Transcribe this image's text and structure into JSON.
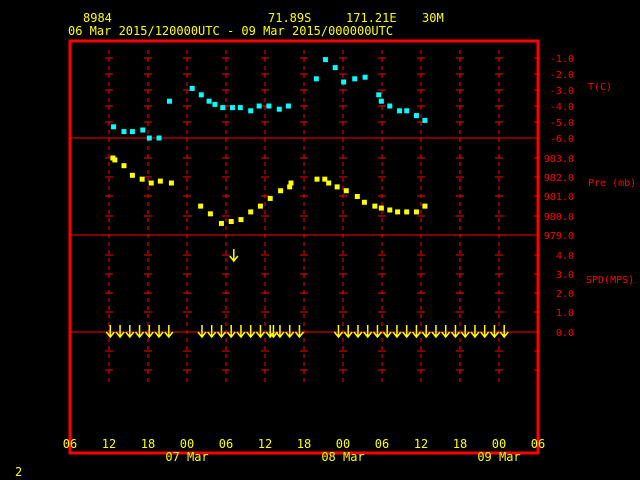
{
  "header": {
    "station_id": "8984",
    "latitude": "71.89S",
    "longitude": "171.21E",
    "elevation": "30M",
    "time_range": "06 Mar 2015/120000UTC - 09 Mar 2015/000000UTC"
  },
  "footer": {
    "corner_label": "2"
  },
  "colors": {
    "background": "#000000",
    "frame": "#ff0000",
    "grid": "#ff0000",
    "axis_text": "#ffff00",
    "header_text": "#ffff00",
    "temperature": "#00ffff",
    "pressure": "#ffff00",
    "wind": "#ffff00"
  },
  "chart_data": {
    "type": "scatter",
    "x_unit": "hours since 06 Mar 2015 06 UTC",
    "x_range": [
      0,
      72
    ],
    "x_tick_labels": [
      "06",
      "12",
      "18",
      "00",
      "06",
      "12",
      "18",
      "00",
      "06",
      "12",
      "18",
      "00",
      "06"
    ],
    "date_labels": [
      {
        "text": "07 Mar",
        "at_tick": 3
      },
      {
        "text": "08 Mar",
        "at_tick": 7
      },
      {
        "text": "09 Mar",
        "at_tick": 11
      }
    ],
    "panels": [
      {
        "name": "temperature",
        "axis_label": "T(C)",
        "y_ticks": [
          "-1.0",
          "-2.0",
          "-3.0",
          "-4.0",
          "-5.0",
          "-6.0"
        ],
        "y_range": [
          -6.3,
          -0.5
        ],
        "series": [
          {
            "points": [
              [
                6.7,
                -5.3
              ],
              [
                8.3,
                -5.6
              ],
              [
                9.6,
                -5.6
              ],
              [
                11.2,
                -5.5
              ],
              [
                12.2,
                -6.0
              ],
              [
                13.7,
                -6.0
              ],
              [
                15.3,
                -3.7
              ],
              [
                18.8,
                -2.9
              ],
              [
                20.2,
                -3.3
              ],
              [
                21.4,
                -3.7
              ],
              [
                22.3,
                -3.9
              ],
              [
                23.5,
                -4.1
              ],
              [
                25.0,
                -4.1
              ],
              [
                26.2,
                -4.1
              ],
              [
                27.8,
                -4.3
              ],
              [
                29.1,
                -4.0
              ],
              [
                30.6,
                -4.0
              ],
              [
                32.2,
                -4.2
              ],
              [
                33.6,
                -4.0
              ],
              [
                37.9,
                -2.3
              ],
              [
                39.3,
                -1.1
              ],
              [
                40.8,
                -1.6
              ],
              [
                42.1,
                -2.5
              ],
              [
                43.8,
                -2.3
              ],
              [
                45.4,
                -2.2
              ],
              [
                47.5,
                -3.3
              ],
              [
                47.9,
                -3.7
              ],
              [
                49.2,
                -4.0
              ],
              [
                50.7,
                -4.3
              ],
              [
                51.8,
                -4.3
              ],
              [
                53.3,
                -4.6
              ],
              [
                54.6,
                -4.9
              ]
            ]
          }
        ]
      },
      {
        "name": "pressure",
        "axis_label": "Pre (mb)",
        "y_ticks": [
          "983.0",
          "982.0",
          "981.0",
          "980.0",
          "979.0"
        ],
        "y_range": [
          978.95,
          983.4
        ],
        "series": [
          {
            "points": [
              [
                6.6,
                983.0
              ],
              [
                6.9,
                982.9
              ],
              [
                8.3,
                982.6
              ],
              [
                9.6,
                982.1
              ],
              [
                11.1,
                981.9
              ],
              [
                12.5,
                981.7
              ],
              [
                13.9,
                981.8
              ],
              [
                15.6,
                981.7
              ],
              [
                20.1,
                980.5
              ],
              [
                21.6,
                980.1
              ],
              [
                23.3,
                979.6
              ],
              [
                24.8,
                979.7
              ],
              [
                26.3,
                979.8
              ],
              [
                27.8,
                980.2
              ],
              [
                29.3,
                980.5
              ],
              [
                30.8,
                980.9
              ],
              [
                32.4,
                981.3
              ],
              [
                33.8,
                981.5
              ],
              [
                34.0,
                981.7
              ],
              [
                38.0,
                981.9
              ],
              [
                39.2,
                981.9
              ],
              [
                39.8,
                981.7
              ],
              [
                41.1,
                981.5
              ],
              [
                42.5,
                981.3
              ],
              [
                44.2,
                981.0
              ],
              [
                45.3,
                980.7
              ],
              [
                46.9,
                980.5
              ],
              [
                47.9,
                980.4
              ],
              [
                49.2,
                980.3
              ],
              [
                50.4,
                980.2
              ],
              [
                51.8,
                980.2
              ],
              [
                53.3,
                980.2
              ],
              [
                54.6,
                980.5
              ]
            ]
          }
        ]
      },
      {
        "name": "wind",
        "axis_label": "SPD(MPS)",
        "y_ticks": [
          "4.0",
          "3.0",
          "2.0",
          "1.0",
          "0.0"
        ],
        "y_range": [
          0,
          4.5
        ],
        "arrow_hours": [
          6.2,
          7.7,
          9.2,
          10.7,
          12.2,
          13.7,
          15.2,
          20.3,
          21.8,
          23.3,
          24.8,
          26.3,
          27.8,
          29.3,
          30.8,
          31.3,
          32.3,
          33.8,
          35.3,
          41.3,
          42.8,
          44.3,
          45.8,
          47.3,
          48.8,
          50.3,
          51.8,
          53.3,
          54.8,
          56.3,
          57.8,
          59.3,
          60.8,
          62.3,
          63.8,
          65.3,
          66.8
        ],
        "standalone_arrow": {
          "hour": 25.2,
          "speed": 4.0
        }
      }
    ]
  }
}
